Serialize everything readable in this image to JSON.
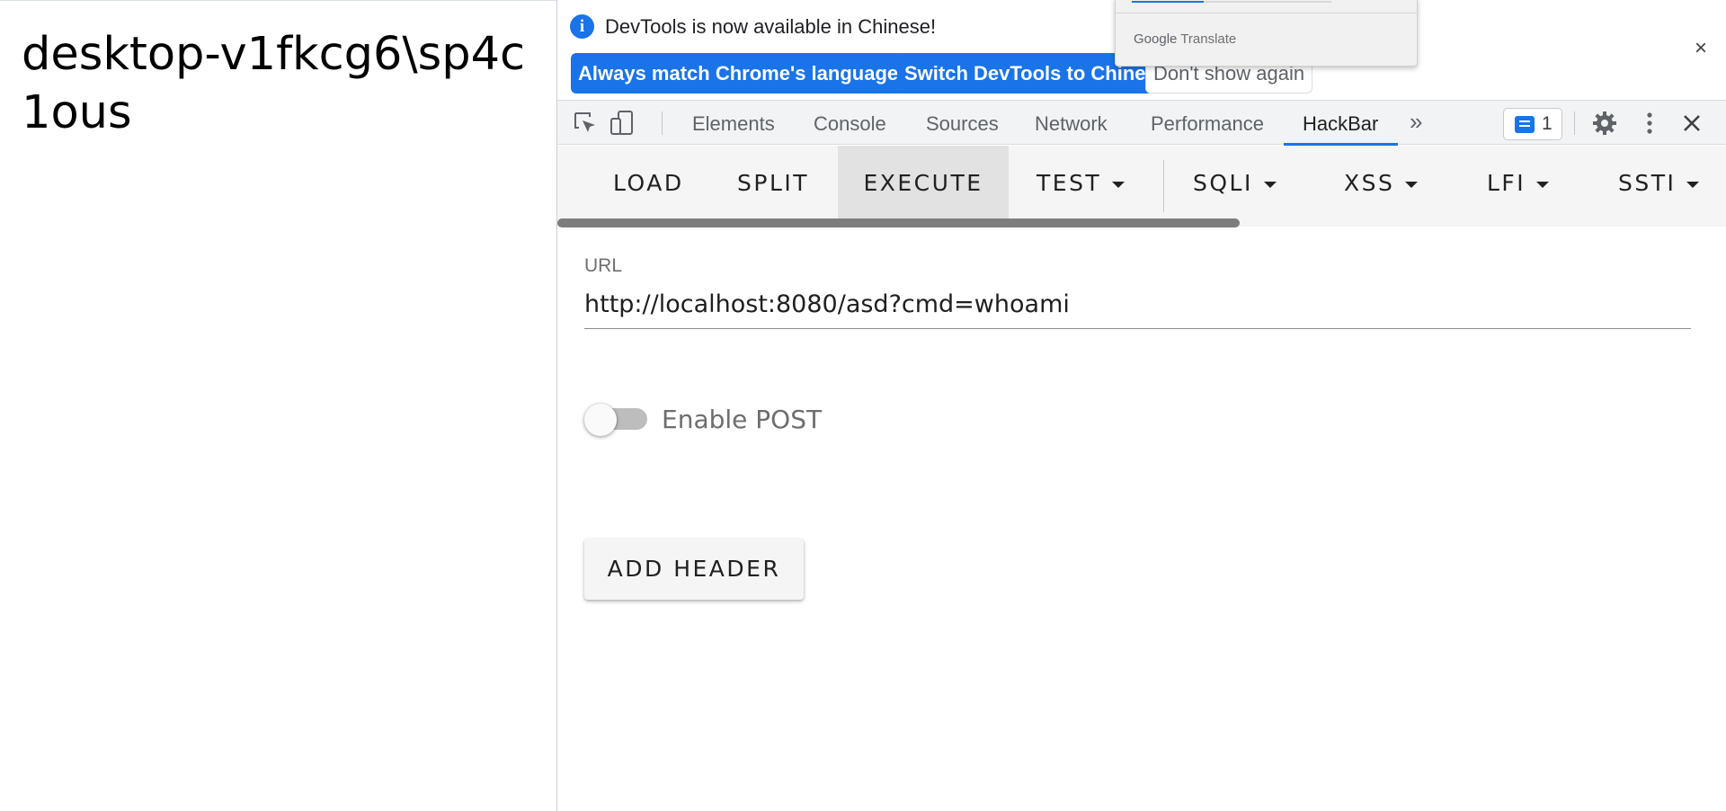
{
  "page": {
    "output": "desktop-v1fkcg6\\sp4c1ous"
  },
  "infobar": {
    "message": "DevTools is now available in Chinese!",
    "buttons": {
      "match": "Always match Chrome's language",
      "switch": "Switch DevTools to Chinese",
      "dismiss": "Don't show again"
    },
    "close": "×"
  },
  "translate_popup": {
    "brand_google": "Google",
    "brand_translate": "Translate"
  },
  "tabs": {
    "items": [
      "Elements",
      "Console",
      "Sources",
      "Network",
      "Performance",
      "HackBar"
    ],
    "active": "HackBar",
    "more": "»",
    "issues_count": "1"
  },
  "hackbar": {
    "toolbar": {
      "load": "LOAD",
      "split": "SPLIT",
      "execute": "EXECUTE",
      "test": "TEST",
      "sqli": "SQLI",
      "xss": "XSS",
      "lfi": "LFI",
      "ssti": "SSTI"
    },
    "url_label": "URL",
    "url_value": "http://localhost:8080/asd?cmd=whoami",
    "enable_post_label": "Enable POST",
    "enable_post": false,
    "add_header": "ADD HEADER"
  },
  "colors": {
    "accent": "#1a73e8",
    "toolbar_bg": "#f5f5f5"
  }
}
